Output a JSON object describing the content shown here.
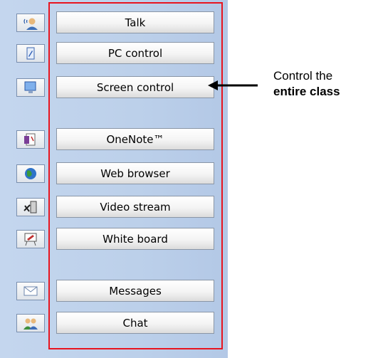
{
  "buttons": [
    {
      "label": "Talk",
      "icon": "talk-icon"
    },
    {
      "label": "PC control",
      "icon": "pc-control-icon"
    },
    {
      "label": "Screen control",
      "icon": "screen-control-icon"
    },
    {
      "label": "OneNote™",
      "icon": "onenote-icon"
    },
    {
      "label": "Web browser",
      "icon": "web-browser-icon"
    },
    {
      "label": "Video stream",
      "icon": "video-stream-icon"
    },
    {
      "label": "White board",
      "icon": "white-board-icon"
    },
    {
      "label": "Messages",
      "icon": "messages-icon"
    },
    {
      "label": "Chat",
      "icon": "chat-icon"
    }
  ],
  "callout": {
    "line1": "Control the",
    "line2": "entire class"
  },
  "colors": {
    "highlight_frame": "#e8141f",
    "panel_background": "#c4d6ee"
  }
}
